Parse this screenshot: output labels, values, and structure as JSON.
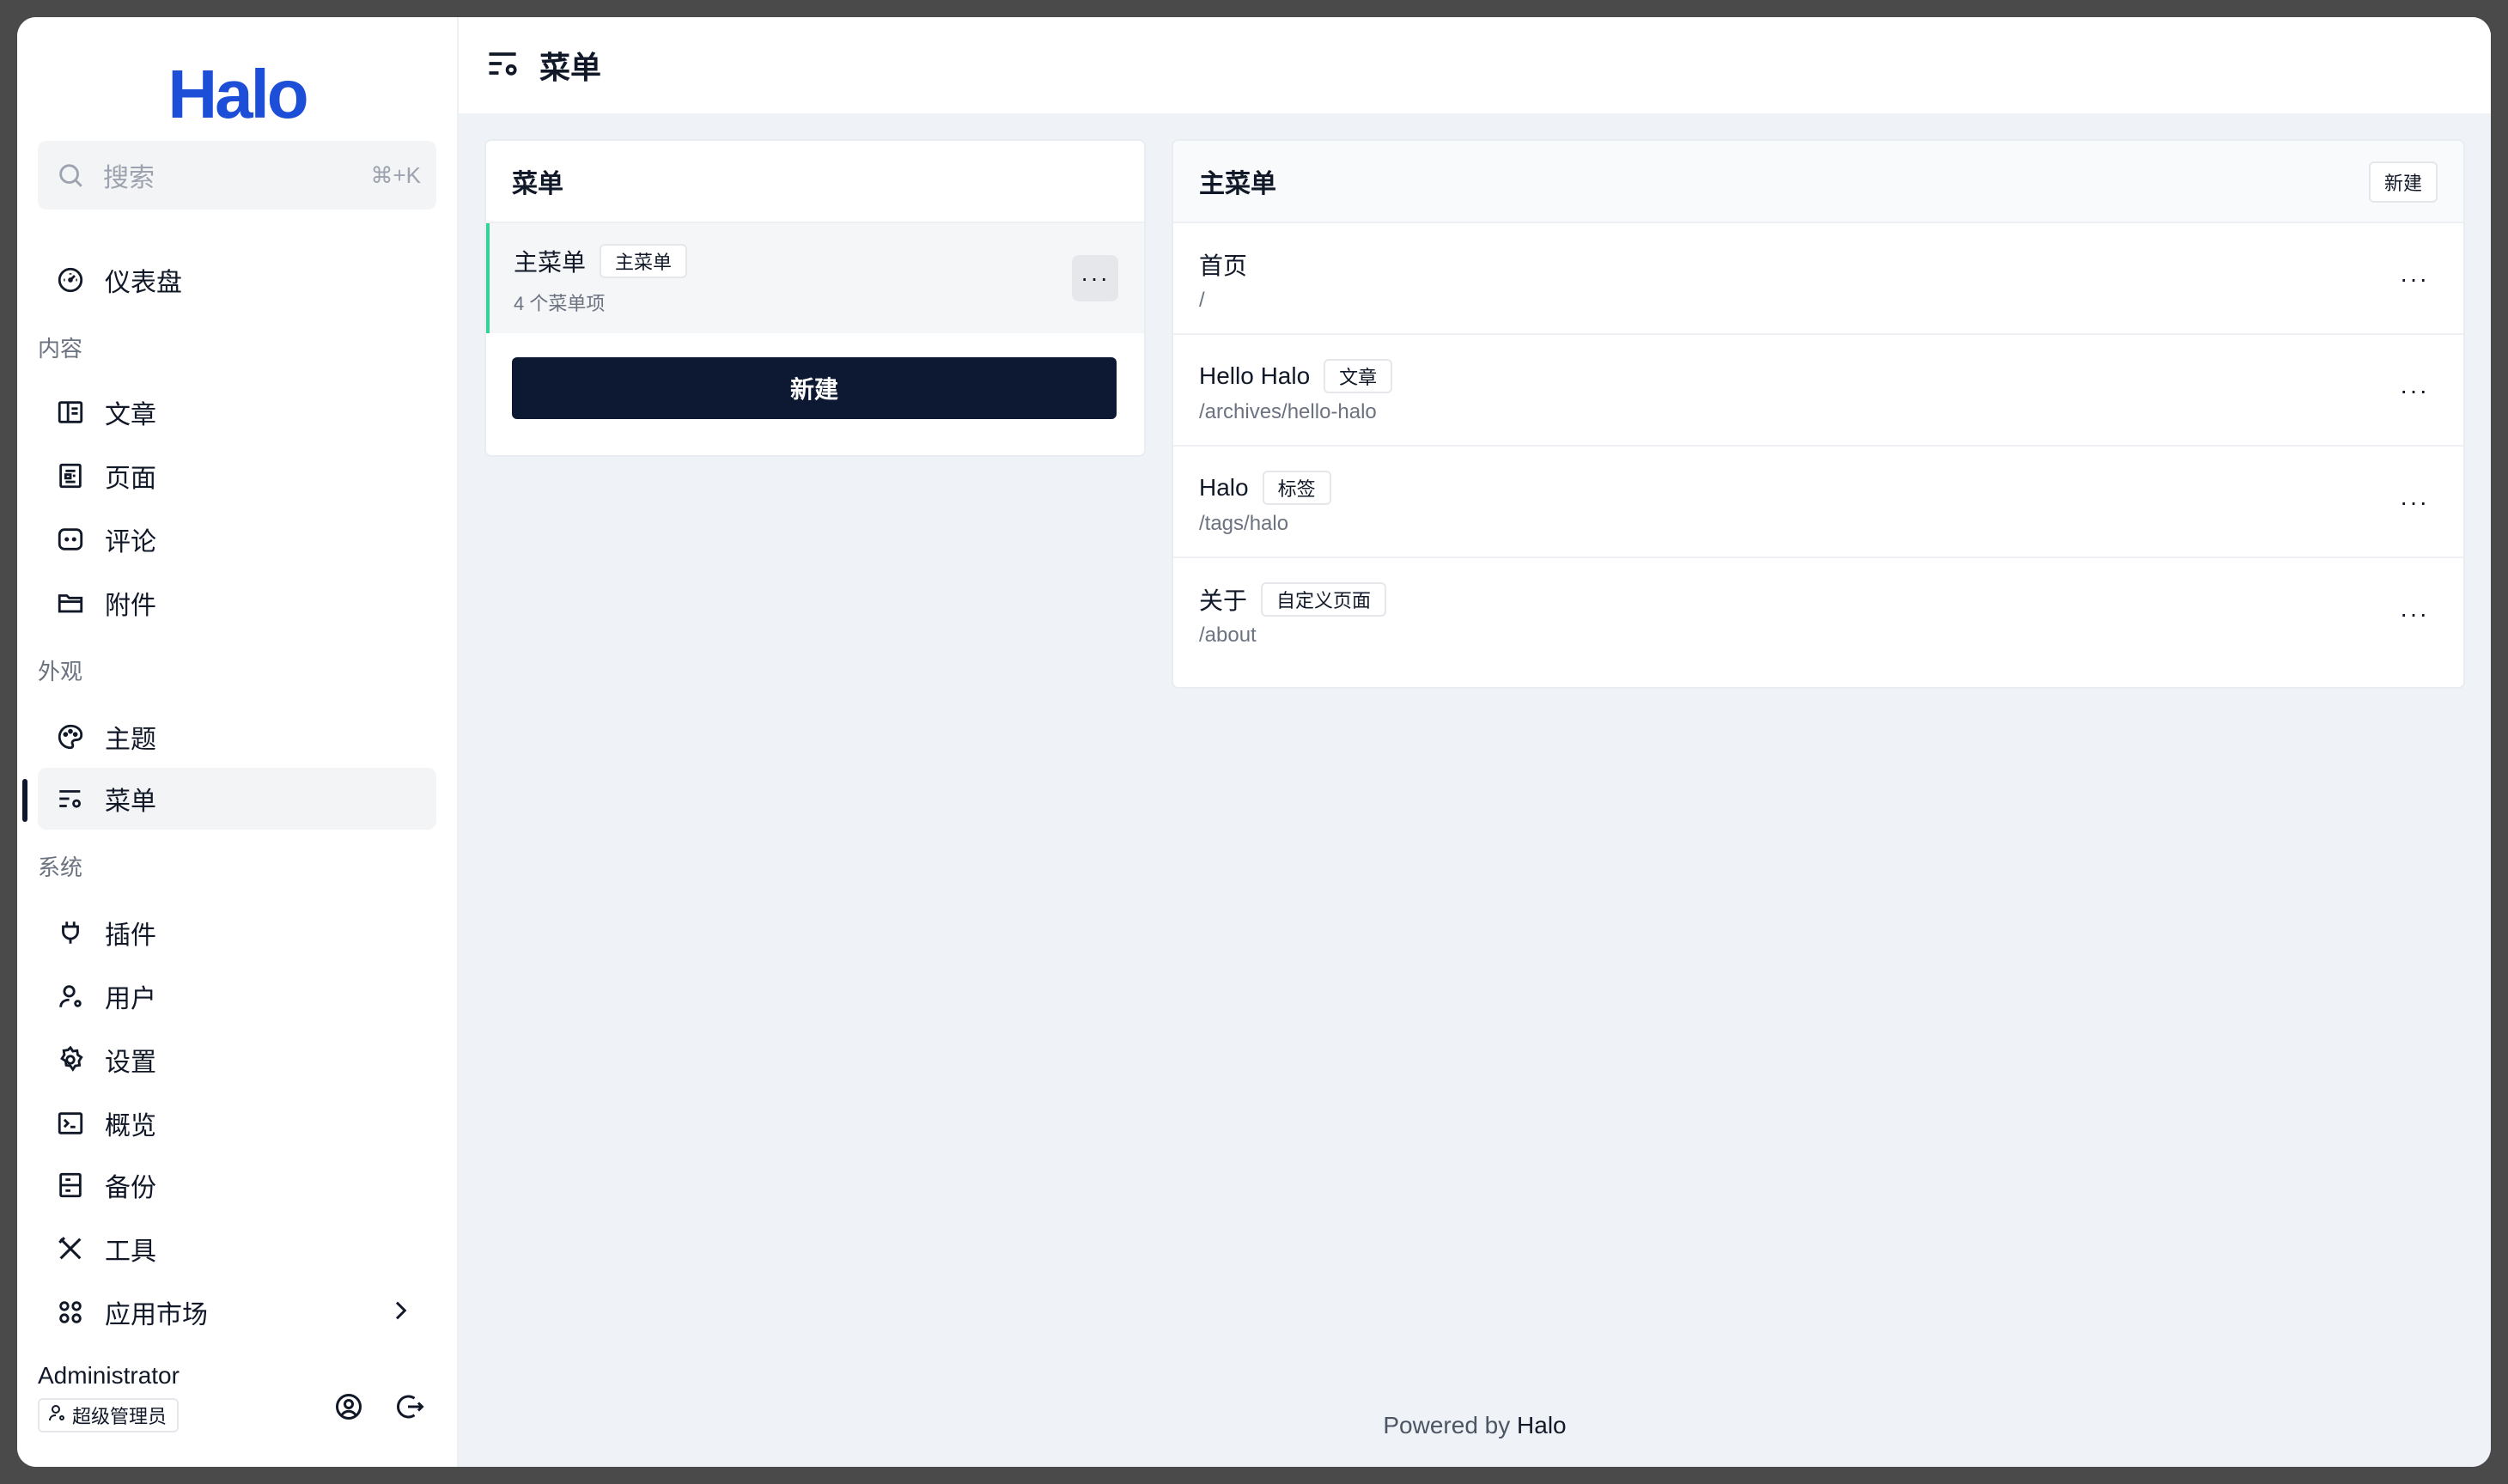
{
  "brand": {
    "logo_text": "Halo",
    "logo_color": "#1d4ed8"
  },
  "search": {
    "placeholder": "搜索",
    "shortcut": "⌘+K"
  },
  "sidebar": {
    "dashboard": {
      "label": "仪表盘",
      "icon": "dashboard-icon"
    },
    "groups": [
      {
        "label": "内容",
        "items": [
          {
            "label": "文章",
            "icon": "post-icon"
          },
          {
            "label": "页面",
            "icon": "page-icon"
          },
          {
            "label": "评论",
            "icon": "comment-icon"
          },
          {
            "label": "附件",
            "icon": "folder-icon"
          }
        ]
      },
      {
        "label": "外观",
        "items": [
          {
            "label": "主题",
            "icon": "palette-icon"
          },
          {
            "label": "菜单",
            "icon": "menu-settings-icon",
            "active": true
          }
        ]
      },
      {
        "label": "系统",
        "items": [
          {
            "label": "插件",
            "icon": "plug-icon"
          },
          {
            "label": "用户",
            "icon": "user-icon"
          },
          {
            "label": "设置",
            "icon": "gear-icon"
          },
          {
            "label": "概览",
            "icon": "terminal-icon"
          },
          {
            "label": "备份",
            "icon": "backup-icon"
          },
          {
            "label": "工具",
            "icon": "tools-icon"
          },
          {
            "label": "应用市场",
            "icon": "apps-icon",
            "has_submenu": true
          }
        ]
      }
    ]
  },
  "user": {
    "name": "Administrator",
    "role": "超级管理员"
  },
  "header": {
    "title": "菜单"
  },
  "menus_panel": {
    "title": "菜单",
    "items": [
      {
        "name": "主菜单",
        "badge": "主菜单",
        "count_text": "4 个菜单项"
      }
    ],
    "new_button": "新建"
  },
  "items_panel": {
    "title": "主菜单",
    "new_button": "新建",
    "items": [
      {
        "name": "首页",
        "badge": "",
        "path": "/"
      },
      {
        "name": "Hello Halo",
        "badge": "文章",
        "path": "/archives/hello-halo"
      },
      {
        "name": "Halo",
        "badge": "标签",
        "path": "/tags/halo"
      },
      {
        "name": "关于",
        "badge": "自定义页面",
        "path": "/about"
      }
    ]
  },
  "footer": {
    "prefix": "Powered by",
    "brand": "Halo"
  },
  "colors": {
    "accent": "#0d1933",
    "selected_border": "#34d399",
    "background": "#eff3f7"
  }
}
